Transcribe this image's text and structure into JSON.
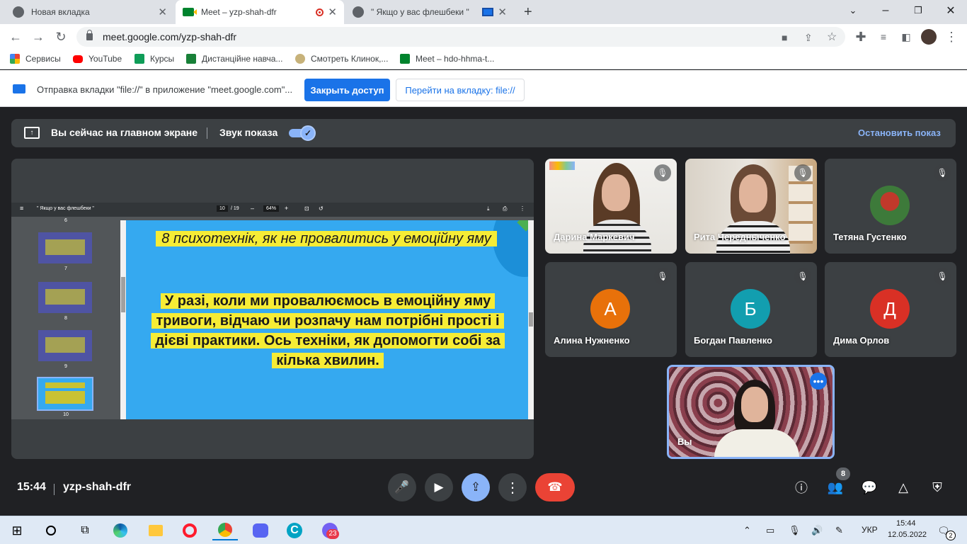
{
  "browser": {
    "tabs": [
      {
        "title": "Новая вкладка",
        "active": false
      },
      {
        "title": "Meet – yzp-shah-dfr",
        "active": true
      },
      {
        "title": "\" Якщо у вас флешбеки \"",
        "active": false
      }
    ],
    "url": "meet.google.com/yzp-shah-dfr",
    "bookmarks": [
      "Сервисы",
      "YouTube",
      "Курсы",
      "Дистанційне навча...",
      "Смотреть Клинок,...",
      "Meet – hdo-hhma-t..."
    ],
    "infobar": {
      "message": "Отправка вкладки \"file://\" в приложение \"meet.google.com\"...",
      "share_button": "Закрыть доступ",
      "goto_button": "Перейти на вкладку: file://"
    }
  },
  "meet": {
    "banner": {
      "presenting_text": "Вы сейчас на главном экране",
      "sound_label": "Звук показа",
      "stop_label": "Остановить показ"
    },
    "pdf": {
      "title": "\" Якщо у вас флешбеки \"",
      "page": "10",
      "pages": "/ 19",
      "zoom": "64%",
      "thumb_numbers": [
        "6",
        "7",
        "8",
        "9",
        "10"
      ],
      "slide_title": "8 психотехнік, як не провалитись у емоційну яму",
      "slide_body": "У разі, коли ми провалюємось в емоційну яму тривоги, відчаю чи розпачу нам потрібні прості і дієві практики. Ось техніки, як допомогти собі за кілька хвилин."
    },
    "participants": [
      {
        "name": "Дарина Маркевич",
        "type": "video"
      },
      {
        "name": "Рита Чередныченко",
        "type": "video"
      },
      {
        "name": "Тетяна Густенко",
        "type": "photo"
      },
      {
        "name": "Алина Нужненко",
        "type": "avatar",
        "initial": "А",
        "color": "#e8710a"
      },
      {
        "name": "Богдан Павленко",
        "type": "avatar",
        "initial": "Б",
        "color": "#129eaf"
      },
      {
        "name": "Дима Орлов",
        "type": "avatar",
        "initial": "Д",
        "color": "#d93025"
      }
    ],
    "self": {
      "name": "Вы"
    },
    "time": "15:44",
    "meeting_code": "yzp-shah-dfr",
    "participant_count": "8"
  },
  "taskbar": {
    "lang": "УКР",
    "time": "15:44",
    "date": "12.05.2022",
    "opera_badge": "23",
    "notif_count": "2"
  }
}
